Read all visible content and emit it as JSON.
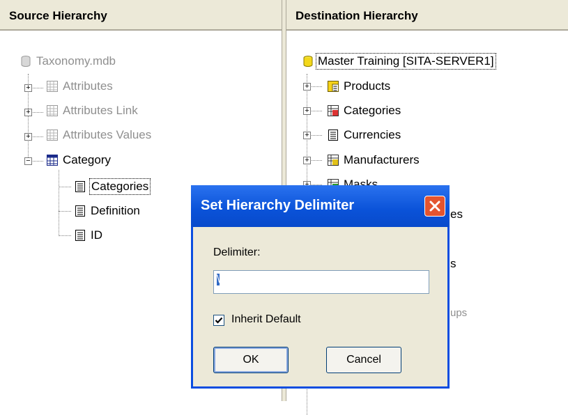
{
  "source": {
    "header": "Source Hierarchy",
    "root": "Taxonomy.mdb",
    "items": [
      "Attributes",
      "Attributes Link",
      "Attributes Values",
      "Category"
    ],
    "children": [
      "Categories",
      "Definition",
      "ID"
    ]
  },
  "destination": {
    "header": "Destination Hierarchy",
    "root": "Master Training [SITA-SERVER1]",
    "items": [
      "Products",
      "Categories",
      "Currencies",
      "Manufacturers",
      "Masks"
    ],
    "partial": [
      "es",
      "s",
      "ups"
    ]
  },
  "dialog": {
    "title": "Set Hierarchy Delimiter",
    "delimiter_label": "Delimiter:",
    "delimiter_value": "\\",
    "inherit_label": "Inherit Default",
    "inherit_checked": true,
    "ok_label": "OK",
    "cancel_label": "Cancel"
  }
}
